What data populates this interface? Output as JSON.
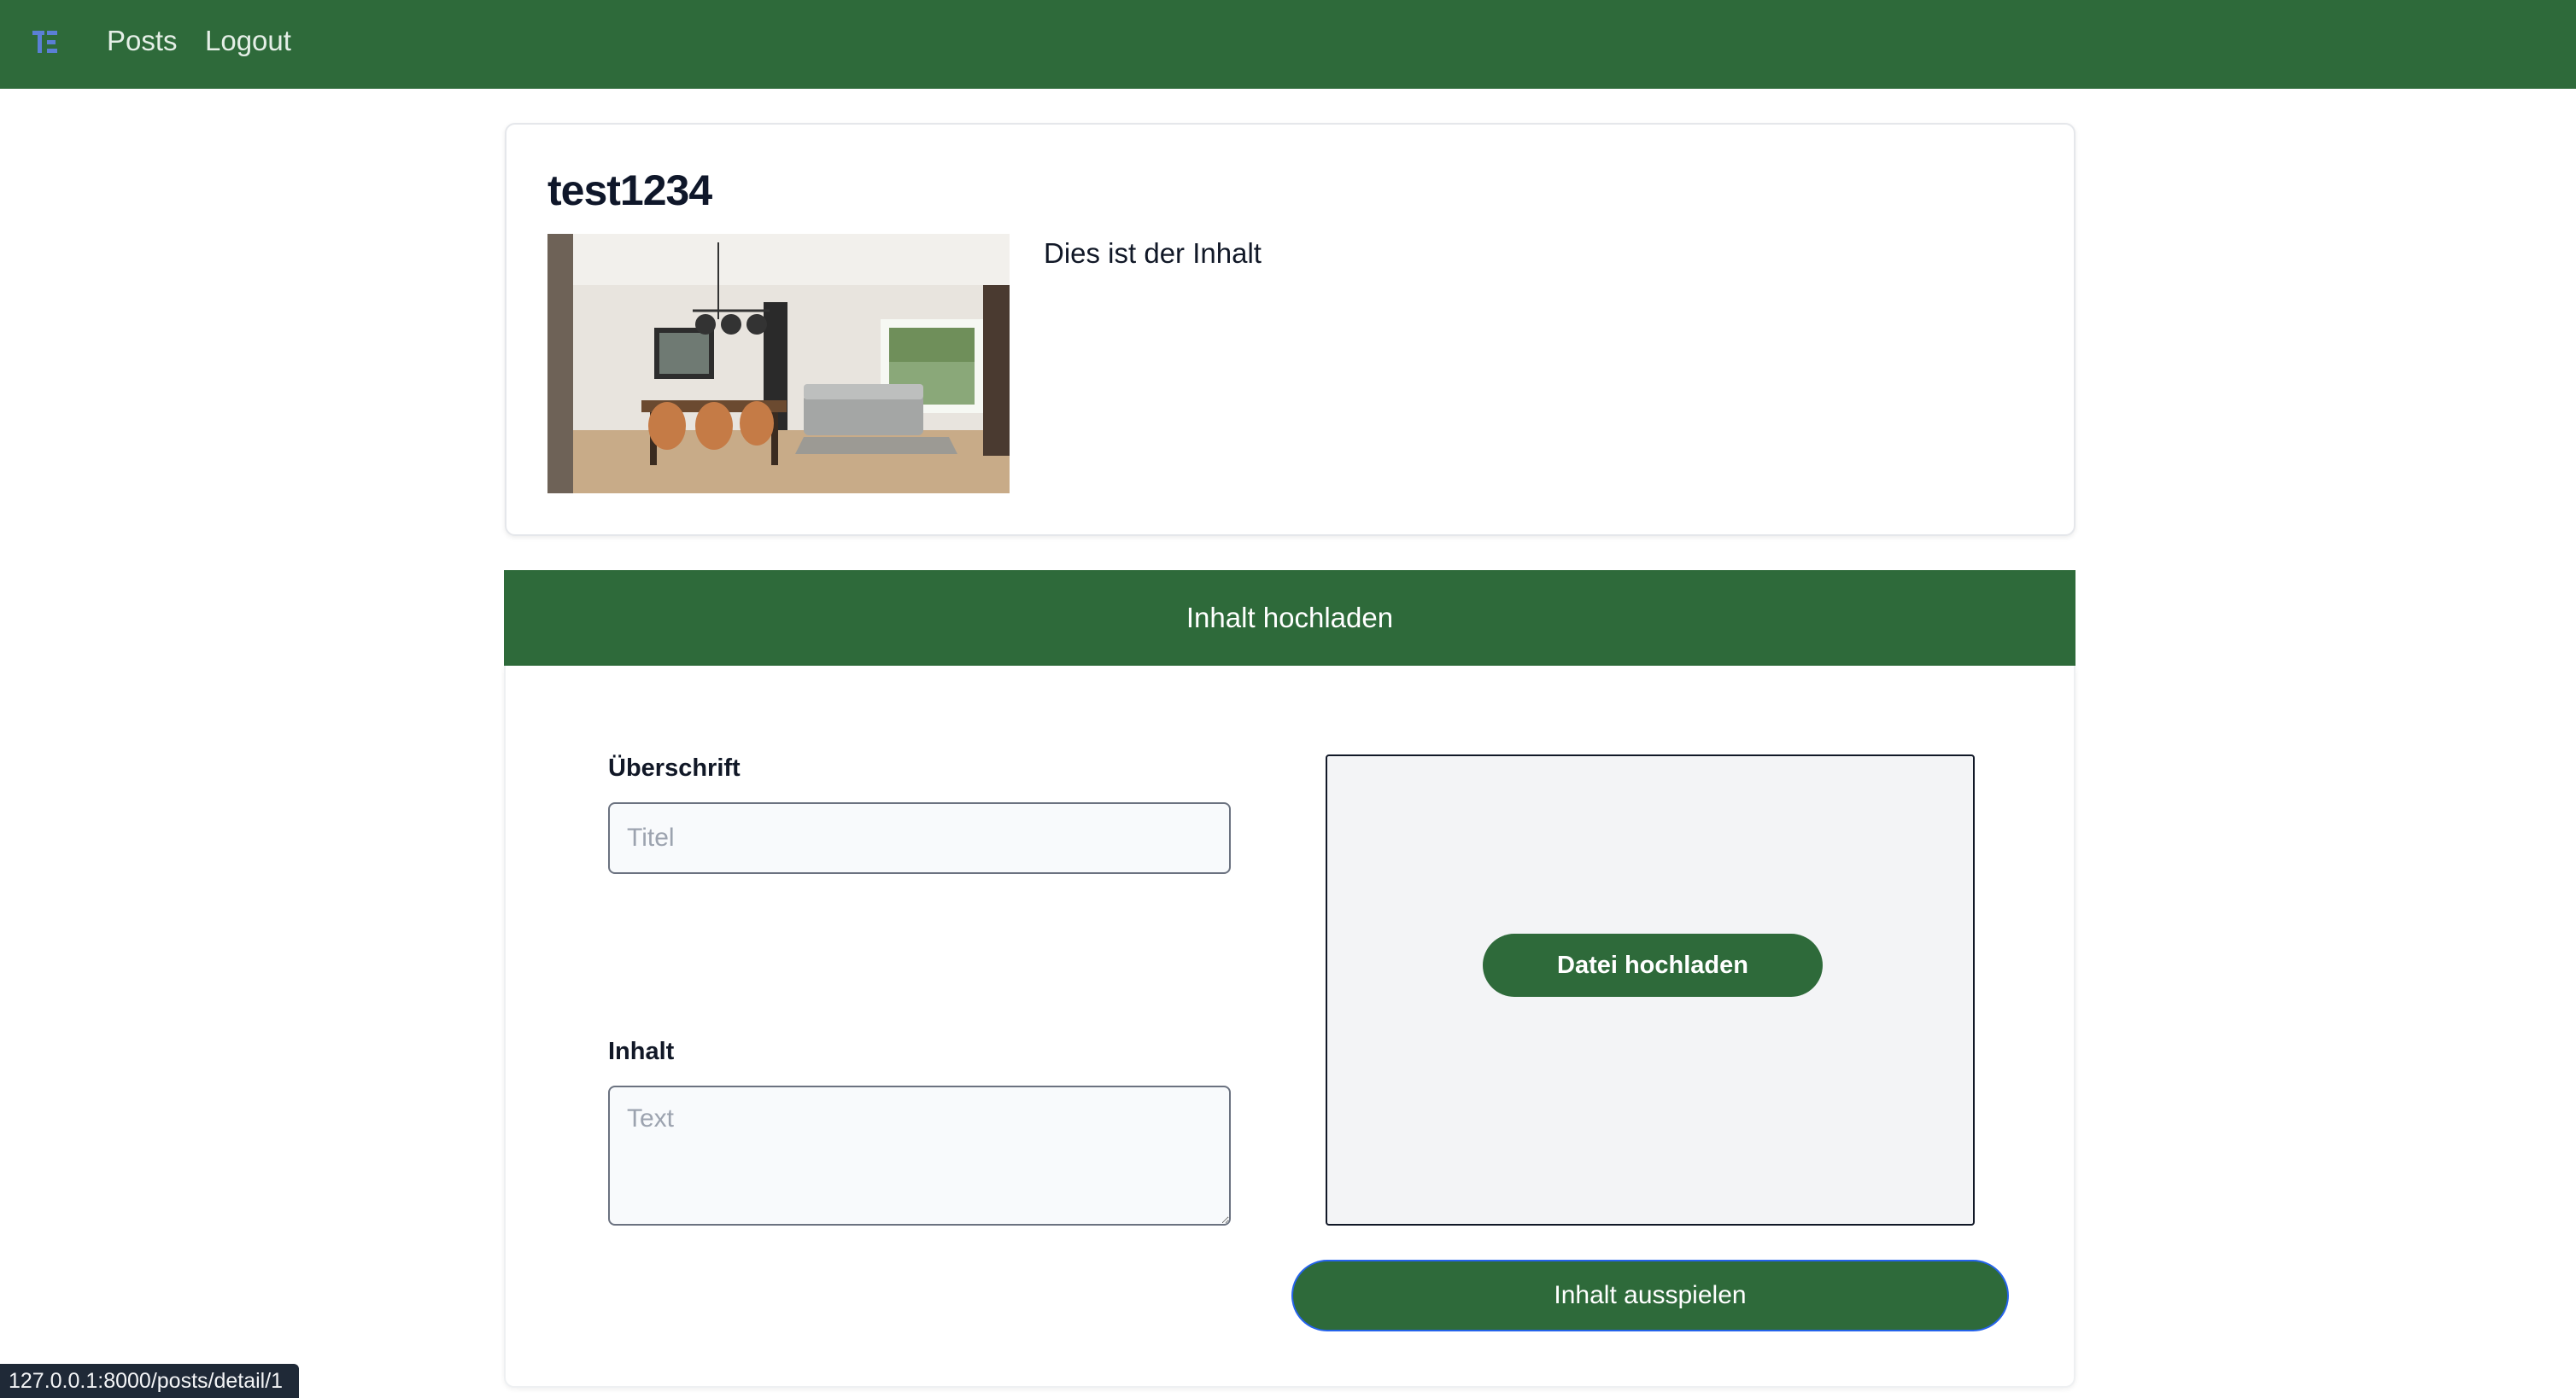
{
  "nav": {
    "logo_icon": "tailwind-logo-icon",
    "links": [
      "Posts",
      "Logout"
    ]
  },
  "post": {
    "title": "test1234",
    "content": "Dies ist der Inhalt",
    "image_icon": "dining-room-photo"
  },
  "upload": {
    "header": "Inhalt hochladen",
    "title_label": "Überschrift",
    "title_placeholder": "Titel",
    "content_label": "Inhalt",
    "content_placeholder": "Text",
    "file_button": "Datei hochladen",
    "submit_button": "Inhalt ausspielen"
  },
  "status_url": "127.0.0.1:8000/posts/detail/1",
  "colors": {
    "brand_green": "#2e6a3a",
    "logo_blue": "#5b7fd6",
    "input_bg": "#f8fafc",
    "dropzone_bg": "#f3f4f6"
  }
}
